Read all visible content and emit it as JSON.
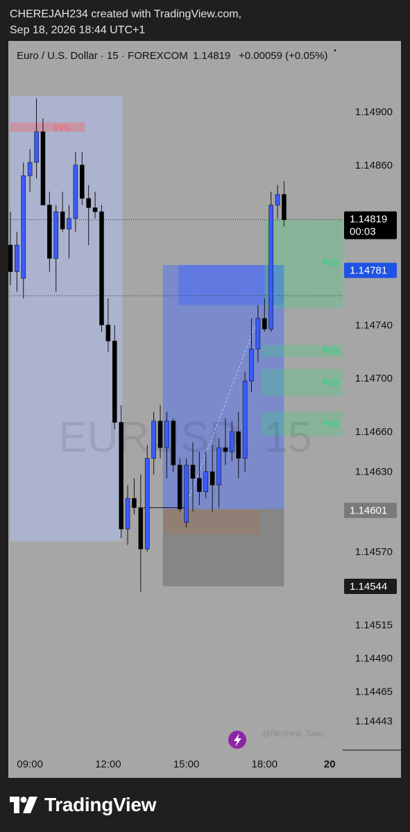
{
  "header": {
    "line1": "CHEREJAH234 created with TradingView.com,",
    "line2": "Sep 18, 2026 18:44 UTC+1"
  },
  "footer": {
    "brand": "TradingView",
    "logo_icon": "tradingview-logo-icon"
  },
  "colors": {
    "bull_body": "#3b5bff",
    "bear_body": "#000000",
    "wick": "#111111",
    "fvg_bear": "#ff5c5c",
    "fvg_bull": "#00e676",
    "last_price_label": "#000000",
    "level_label": "#1e53e5"
  },
  "chart_data": {
    "type": "candlestick",
    "title": "Euro / U.S. Dollar · 15 · FOREXCOM",
    "last_price": "1.14819",
    "change": "+0.00059 (+0.05%)",
    "watermark": "EURUSD, 15",
    "credit": "@Nephew_Sam_",
    "ylim": [
      1.1443,
      1.1494
    ],
    "y_ticks": [
      "1.14900",
      "1.14860",
      "1.14740",
      "1.14700",
      "1.14660",
      "1.14630",
      "1.14570",
      "1.14515",
      "1.14490",
      "1.14465",
      "1.14443"
    ],
    "x_ticks": [
      "09:00",
      "12:00",
      "15:00",
      "18:00",
      "20"
    ],
    "price_labels": [
      {
        "text": "1.14819",
        "sub": "00:03",
        "value": 1.14819,
        "style": "last"
      },
      {
        "text": "1.14781",
        "value": 1.14781,
        "style": "blue"
      },
      {
        "text": "1.14601",
        "value": 1.14601,
        "style": "gray"
      },
      {
        "text": "1.14544",
        "value": 1.14544,
        "style": "dark"
      }
    ],
    "time_range": [
      8.25,
      21.0
    ],
    "x_tick_times": [
      9.0,
      12.0,
      15.0,
      18.0,
      20.5
    ],
    "zones": [
      {
        "t0": 8.25,
        "t1": 12.55,
        "p0": 1.14912,
        "p1": 1.14578,
        "kind": "lavender"
      },
      {
        "t0": 14.1,
        "t1": 18.75,
        "p0": 1.14785,
        "p1": 1.14602,
        "kind": "blue"
      },
      {
        "t0": 14.7,
        "t1": 18.75,
        "p0": 1.14785,
        "p1": 1.14755,
        "kind": "blue"
      },
      {
        "t0": 14.1,
        "t1": 17.8,
        "p0": 1.14602,
        "p1": 1.14583,
        "kind": "salmon"
      },
      {
        "t0": 14.1,
        "t1": 18.75,
        "p0": 1.14602,
        "p1": 1.14544,
        "kind": "gray"
      },
      {
        "t0": 18.0,
        "t1": 21.0,
        "p0": 1.14819,
        "p1": 1.14753,
        "kind": "green"
      },
      {
        "t0": 17.9,
        "t1": 21.0,
        "p0": 1.14725,
        "p1": 1.14716,
        "kind": "green"
      },
      {
        "t0": 17.9,
        "t1": 21.0,
        "p0": 1.14707,
        "p1": 1.14687,
        "kind": "green"
      },
      {
        "t0": 17.9,
        "t1": 21.0,
        "p0": 1.14675,
        "p1": 1.14657,
        "kind": "green"
      },
      {
        "t0": 8.25,
        "t1": 11.1,
        "p0": 1.14892,
        "p1": 1.14885,
        "kind": "red"
      }
    ],
    "fvg_labels": [
      {
        "text": "FVG",
        "t": 10.3,
        "p": 1.14888,
        "color": "red"
      },
      {
        "text": "FVG",
        "t": 20.9,
        "p": 1.14787,
        "color": "green"
      },
      {
        "text": "FVG",
        "t": 20.9,
        "p": 1.14721,
        "color": "green"
      },
      {
        "text": "FVG",
        "t": 20.9,
        "p": 1.14697,
        "color": "green"
      },
      {
        "text": "FVG",
        "t": 20.9,
        "p": 1.14666,
        "color": "green"
      }
    ],
    "dotted_levels": [
      1.14819,
      1.14762
    ],
    "horizontal_line": {
      "t0": 13.35,
      "t1": 15.0,
      "p": 1.14603
    },
    "diagonal": {
      "t0": 14.9,
      "p0": 1.146,
      "t1": 17.65,
      "p1": 1.1474
    },
    "candles": [
      {
        "t": 8.25,
        "o": 1.148,
        "h": 1.14825,
        "l": 1.1477,
        "c": 1.1478
      },
      {
        "t": 8.5,
        "o": 1.1478,
        "h": 1.1481,
        "l": 1.14765,
        "c": 1.148
      },
      {
        "t": 8.75,
        "o": 1.14775,
        "h": 1.14862,
        "l": 1.1476,
        "c": 1.14852
      },
      {
        "t": 9.0,
        "o": 1.14852,
        "h": 1.14872,
        "l": 1.1484,
        "c": 1.14862
      },
      {
        "t": 9.25,
        "o": 1.14862,
        "h": 1.1491,
        "l": 1.1485,
        "c": 1.14885
      },
      {
        "t": 9.5,
        "o": 1.14885,
        "h": 1.14895,
        "l": 1.1483,
        "c": 1.1483
      },
      {
        "t": 9.75,
        "o": 1.1483,
        "h": 1.1484,
        "l": 1.1478,
        "c": 1.1479
      },
      {
        "t": 10.0,
        "o": 1.1479,
        "h": 1.1483,
        "l": 1.14765,
        "c": 1.14825
      },
      {
        "t": 10.25,
        "o": 1.14825,
        "h": 1.1484,
        "l": 1.1481,
        "c": 1.14812
      },
      {
        "t": 10.5,
        "o": 1.14812,
        "h": 1.1483,
        "l": 1.1479,
        "c": 1.1482
      },
      {
        "t": 10.75,
        "o": 1.1482,
        "h": 1.1487,
        "l": 1.1481,
        "c": 1.1486
      },
      {
        "t": 11.0,
        "o": 1.1486,
        "h": 1.1487,
        "l": 1.1483,
        "c": 1.14835
      },
      {
        "t": 11.25,
        "o": 1.14835,
        "h": 1.14845,
        "l": 1.148,
        "c": 1.14828
      },
      {
        "t": 11.5,
        "o": 1.14828,
        "h": 1.1484,
        "l": 1.1482,
        "c": 1.14825
      },
      {
        "t": 11.75,
        "o": 1.14825,
        "h": 1.1483,
        "l": 1.14735,
        "c": 1.1474
      },
      {
        "t": 12.0,
        "o": 1.1474,
        "h": 1.1476,
        "l": 1.1472,
        "c": 1.14728
      },
      {
        "t": 12.25,
        "o": 1.14728,
        "h": 1.1474,
        "l": 1.14662,
        "c": 1.14667
      },
      {
        "t": 12.5,
        "o": 1.14667,
        "h": 1.1468,
        "l": 1.1458,
        "c": 1.14587
      },
      {
        "t": 12.75,
        "o": 1.14587,
        "h": 1.1462,
        "l": 1.14575,
        "c": 1.1461
      },
      {
        "t": 13.0,
        "o": 1.1461,
        "h": 1.14625,
        "l": 1.14598,
        "c": 1.14603
      },
      {
        "t": 13.25,
        "o": 1.14603,
        "h": 1.14628,
        "l": 1.1454,
        "c": 1.14572
      },
      {
        "t": 13.5,
        "o": 1.14572,
        "h": 1.1465,
        "l": 1.1457,
        "c": 1.1464
      },
      {
        "t": 13.75,
        "o": 1.1464,
        "h": 1.14675,
        "l": 1.14628,
        "c": 1.14668
      },
      {
        "t": 14.0,
        "o": 1.14668,
        "h": 1.1468,
        "l": 1.1464,
        "c": 1.14648
      },
      {
        "t": 14.25,
        "o": 1.14648,
        "h": 1.14675,
        "l": 1.14625,
        "c": 1.14668
      },
      {
        "t": 14.5,
        "o": 1.14668,
        "h": 1.1467,
        "l": 1.1463,
        "c": 1.14635
      },
      {
        "t": 14.75,
        "o": 1.14635,
        "h": 1.1464,
        "l": 1.146,
        "c": 1.14602
      },
      {
        "t": 15.0,
        "o": 1.14592,
        "h": 1.1464,
        "l": 1.14588,
        "c": 1.14635
      },
      {
        "t": 15.25,
        "o": 1.14635,
        "h": 1.14652,
        "l": 1.146,
        "c": 1.14625
      },
      {
        "t": 15.5,
        "o": 1.14625,
        "h": 1.14645,
        "l": 1.14605,
        "c": 1.14615
      },
      {
        "t": 15.75,
        "o": 1.14615,
        "h": 1.14645,
        "l": 1.1461,
        "c": 1.1463
      },
      {
        "t": 16.0,
        "o": 1.1463,
        "h": 1.1465,
        "l": 1.146,
        "c": 1.1462
      },
      {
        "t": 16.25,
        "o": 1.1462,
        "h": 1.14655,
        "l": 1.14603,
        "c": 1.14648
      },
      {
        "t": 16.5,
        "o": 1.14648,
        "h": 1.1467,
        "l": 1.14635,
        "c": 1.14645
      },
      {
        "t": 16.75,
        "o": 1.14645,
        "h": 1.14668,
        "l": 1.14638,
        "c": 1.1466
      },
      {
        "t": 17.0,
        "o": 1.1466,
        "h": 1.14675,
        "l": 1.14625,
        "c": 1.1464
      },
      {
        "t": 17.25,
        "o": 1.1464,
        "h": 1.14705,
        "l": 1.1463,
        "c": 1.14698
      },
      {
        "t": 17.5,
        "o": 1.14698,
        "h": 1.14745,
        "l": 1.1469,
        "c": 1.14722
      },
      {
        "t": 17.75,
        "o": 1.14722,
        "h": 1.14755,
        "l": 1.14712,
        "c": 1.14745
      },
      {
        "t": 18.0,
        "o": 1.14745,
        "h": 1.1476,
        "l": 1.14735,
        "c": 1.14737
      },
      {
        "t": 18.25,
        "o": 1.14737,
        "h": 1.1484,
        "l": 1.14735,
        "c": 1.1483
      },
      {
        "t": 18.5,
        "o": 1.1483,
        "h": 1.14845,
        "l": 1.1482,
        "c": 1.14838
      },
      {
        "t": 18.75,
        "o": 1.14838,
        "h": 1.14848,
        "l": 1.14814,
        "c": 1.14819
      }
    ]
  }
}
